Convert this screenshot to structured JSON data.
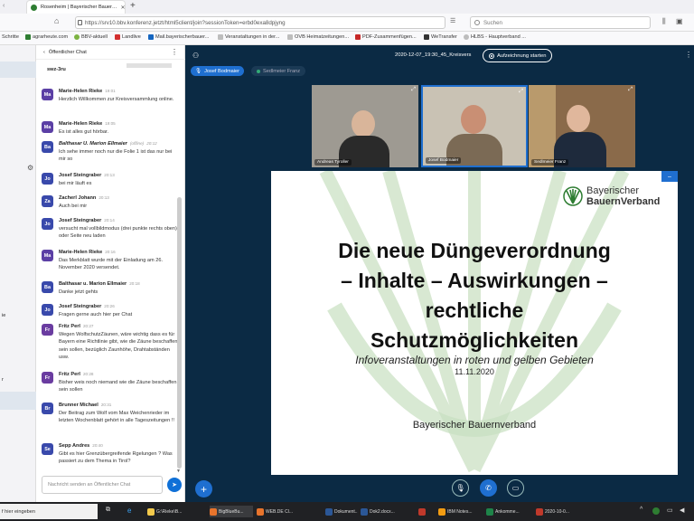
{
  "browser": {
    "tabs": [
      {
        "label": "Rosenheim | Bayerischer Bauer…",
        "active": true
      }
    ],
    "new_tab_icon": "plus-icon",
    "url": "https://srv10.bbv.konferenz.jetzt/html5client/join?sessionToken=erbd0exa8dpjyng",
    "url_domain": "konferenz.jetzt",
    "search_placeholder": "Suchen"
  },
  "bookmarks": [
    {
      "label": "Schritte",
      "color": "#999999"
    },
    {
      "label": "agrarheute.com",
      "color": "#2e7d32"
    },
    {
      "label": "BBV-aktuell",
      "color": "#7cb342"
    },
    {
      "label": "Landlive",
      "color": "#d32f2f"
    },
    {
      "label": "Mail.bayerischerbauer...",
      "color": "#1565c0"
    },
    {
      "label": "Veranstaltungen in der...",
      "color": "#9e9e9e"
    },
    {
      "label": "OVB Heimatzeitungen...",
      "color": "#9e9e9e"
    },
    {
      "label": "PDF-Zusammenfügen...",
      "color": "#c62828"
    },
    {
      "label": "WeTransfer",
      "color": "#333333"
    },
    {
      "label": "HLBS - Hauptverband ...",
      "color": "#9e9e9e"
    }
  ],
  "sidebar_stub": {
    "fragments": [
      "ie",
      "r"
    ]
  },
  "chat": {
    "title": "Öffentlicher Chat",
    "room_line": "swz-3ru",
    "input_placeholder": "Nachricht senden an Öffentlicher Chat",
    "messages": [
      {
        "initials": "Ma",
        "name": "Marie-Helen Rieke",
        "time": "19:01",
        "text": "Herzlich Willkommen zur Kreisversammlung online.",
        "color": "#5b3fa5"
      },
      {
        "initials": "Ma",
        "name": "Marie-Helen Rieke",
        "time": "19:05",
        "text": "Es ist alles gut hörbar.",
        "color": "#5b3fa5"
      },
      {
        "initials": "Ba",
        "name": "Balthasar U. Marion Ellmaier",
        "time": "20:12",
        "status": "(offline)",
        "text": "Ich sehe immer noch nur die Folie 1 ist das nur bei mir so",
        "color": "#3949ab",
        "italic": true
      },
      {
        "initials": "Jo",
        "name": "Josef Steingraber",
        "time": "20:13",
        "text": "bei mir läuft es",
        "color": "#3949ab"
      },
      {
        "initials": "Za",
        "name": "Zacherl Johann",
        "time": "20:13",
        "text": "Auch bei mir",
        "color": "#3949ab"
      },
      {
        "initials": "Jo",
        "name": "Josef Steingraber",
        "time": "20:14",
        "text": "versucht mal vollbildmodus (drei punkte rechts oben) oder Seite neu laden",
        "color": "#3949ab"
      },
      {
        "initials": "Ma",
        "name": "Marie-Helen Rieke",
        "time": "20:16",
        "text": "Das Merkblatt wurde mit der Einladung am 26. November 2020 versendet.",
        "color": "#5b3fa5"
      },
      {
        "initials": "Ba",
        "name": "Balthasar u. Marion Ellmaier",
        "time": "20:18",
        "text": "Danke jetzt gehts",
        "color": "#3949ab"
      },
      {
        "initials": "Jo",
        "name": "Josef Steingraber",
        "time": "20:26",
        "text": "Fragen gerne auch hier per Chat",
        "color": "#3949ab"
      },
      {
        "initials": "Fr",
        "name": "Fritz Perl",
        "time": "20:27",
        "text": "Wegen WolfschutzZäunen, wäre wichtig dass es für Bayern eine Richtlinie gibt, wie die Zäune beschaffen sein sollen, bezüglich Zaunhöhe, Drahtabständen usw.",
        "color": "#6a3ca0"
      },
      {
        "initials": "Fr",
        "name": "Fritz Perl",
        "time": "20:28",
        "text": "Bisher weis noch niemand wie die Zäune beschaffen sein sollen",
        "color": "#6a3ca0"
      },
      {
        "initials": "Br",
        "name": "Brunner Michael",
        "time": "20:31",
        "text": "Der Beitrag zum Wolf vom Max Weichenrieder im letzten Wochenblatt gehört in alle Tageszeitungen !!",
        "color": "#3949ab"
      },
      {
        "initials": "Se",
        "name": "Sepp Andres",
        "time": "20:40",
        "text": "Gibt es hier Grenzübergreifende Rgelungen ? Was passiert zu dem Thema in Tirol?",
        "color": "#3949ab"
      }
    ]
  },
  "meeting": {
    "session_name": "2020-12-07_19:30_45_Kreisvers",
    "record_label": "Aufzeichnung starten",
    "presenters": [
      "Josef Bodmaier",
      "Sedlmeier Franz"
    ],
    "videos": [
      {
        "name": "Andreas Tyroller"
      },
      {
        "name": "Josef Bodmaier"
      },
      {
        "name": "Sedlmeier Franz"
      }
    ],
    "slide": {
      "logo_line1": "Bayerischer",
      "logo_line2": "BauernVerband",
      "title_lines": [
        "Die neue Düngeverordnung",
        "– Inhalte – Auswirkungen –",
        "rechtliche",
        "Schutzmöglichkeiten"
      ],
      "subtitle": "Infoveranstaltungen in roten und gelben Gebieten",
      "date": "11.11.2020",
      "footer": "Bayerischer Bauernverband"
    }
  },
  "taskbar": {
    "search_text": "f hier eingeben",
    "items": [
      {
        "label": "G:\\Rieke\\B...",
        "color": "#f2c94c"
      },
      {
        "label": "BigBlueBu...",
        "color": "#e8742c"
      },
      {
        "label": "WEB.DE Cl...",
        "color": "#e8742c"
      },
      {
        "label": "Dokument...",
        "color": "#2b5797"
      },
      {
        "label": "Dok2.docx...",
        "color": "#2b5797"
      },
      {
        "label": "",
        "color": "#c0392b"
      },
      {
        "label": "IBM Notes...",
        "color": "#f39c12"
      },
      {
        "label": "Ankomme...",
        "color": "#1e8449"
      },
      {
        "label": "2020-10-0...",
        "color": "#c0392b"
      }
    ]
  }
}
